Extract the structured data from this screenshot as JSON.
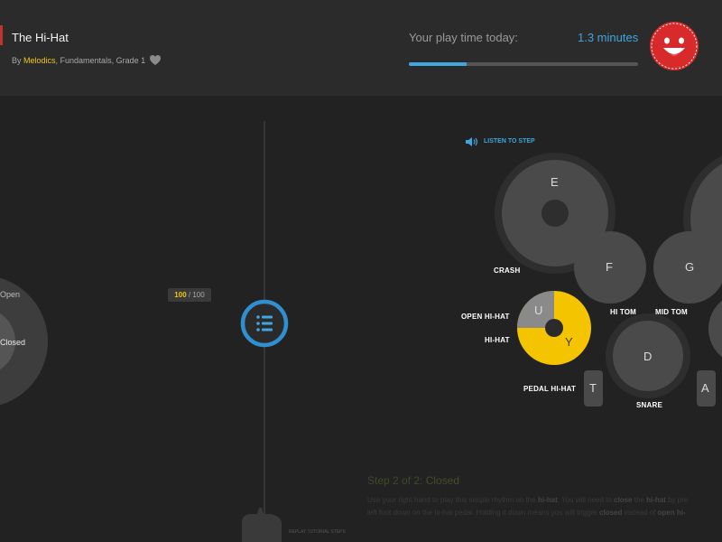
{
  "header": {
    "lesson_title": "The Hi-Hat",
    "byline_prefix": "By ",
    "byline_brand": "Melodics",
    "byline_rest": ", Fundamentals, Grade 1",
    "play_time_label": "Your play time today:",
    "play_time_value": "1.3 minutes",
    "play_time_progress": 0.25
  },
  "timeline": {
    "score_current": "100",
    "score_separator": " / ",
    "score_total": "100",
    "left_note_open": "Open",
    "left_note_closed": "Closed"
  },
  "pads": {
    "listen_to_step": "LISTEN TO STEP",
    "crash": {
      "label": "CRASH",
      "key": "E"
    },
    "hi_tom": {
      "label": "HI TOM",
      "key": "F"
    },
    "mid_tom": {
      "label": "MID TOM",
      "key": "G"
    },
    "open_hihat": {
      "label": "OPEN HI-HAT",
      "key": "U"
    },
    "hihat": {
      "label": "HI-HAT",
      "key": "Y"
    },
    "snare": {
      "label": "SNARE",
      "key": "D"
    },
    "pedal_hihat": {
      "label": "PEDAL HI-HAT",
      "key": "T"
    },
    "right_key": {
      "key": "A"
    }
  },
  "instructions": {
    "step_prefix": "Step 2 of 2:",
    "step_name": "Closed",
    "line1_pre": "Use your right hand to play this simple rhythm on the ",
    "line1_b1": "hi-hat",
    "line1_mid": ". You will need to ",
    "line1_b2": "close",
    "line1_mid2": " the ",
    "line1_b3": "hi-hat",
    "line1_post": " by pre",
    "line2_pre": "left foot down on the hi-hat pedal. Holding it down means you will trigger ",
    "line2_b1": "closed",
    "line2_mid": " instead of ",
    "line2_b2": "open hi-",
    "replay_label": "REPLAY TUTORIAL STEPS"
  },
  "colors": {
    "accent_blue": "#3fa6e0",
    "brand_yellow": "#f2c70f",
    "avatar_red": "#d82a2a"
  }
}
